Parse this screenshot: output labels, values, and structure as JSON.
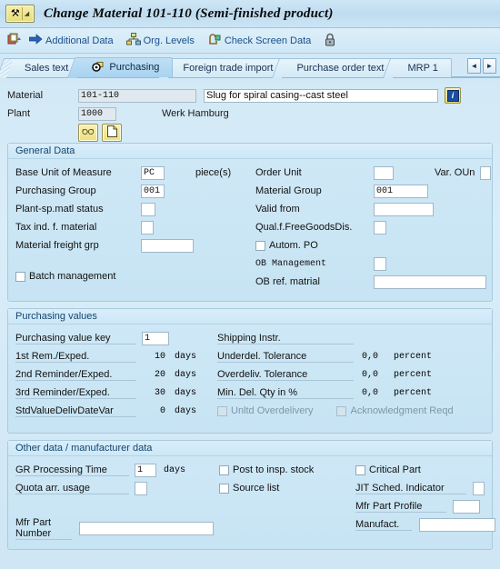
{
  "window": {
    "title": "Change Material 101-110 (Semi-finished product)",
    "system_icon": "sap-material-icon"
  },
  "toolbar": {
    "items": [
      {
        "icon": "create-copy-icon",
        "label": ""
      },
      {
        "icon": "arrow-right-icon",
        "label": "Additional Data"
      },
      {
        "icon": "org-levels-icon",
        "label": "Org. Levels"
      },
      {
        "icon": "check-screen-icon",
        "label": "Check Screen Data"
      },
      {
        "icon": "lock-icon",
        "label": ""
      }
    ]
  },
  "tabs": {
    "items": [
      {
        "label": "Sales text",
        "active": false,
        "icon": ""
      },
      {
        "label": "Purchasing",
        "active": true,
        "icon": "purchasing-icon"
      },
      {
        "label": "Foreign trade import",
        "active": false,
        "icon": ""
      },
      {
        "label": "Purchase order text",
        "active": false,
        "icon": ""
      },
      {
        "label": "MRP 1",
        "active": false,
        "icon": ""
      }
    ],
    "nav_prev": "◄",
    "nav_next": "►"
  },
  "header": {
    "material_label": "Material",
    "material_value": "101-110",
    "material_desc": "Slug for spiral casing--cast steel",
    "plant_label": "Plant",
    "plant_value": "1000",
    "plant_desc": "Werk Hamburg",
    "info_icon": "info-icon",
    "long_text_icon": "glasses-icon",
    "doc_icon": "document-icon"
  },
  "general_data": {
    "title": "General Data",
    "base_unit_label": "Base Unit of Measure",
    "base_unit_value": "PC",
    "base_unit_text": "piece(s)",
    "purchasing_group_label": "Purchasing Group",
    "purchasing_group_value": "001",
    "plant_status_label": "Plant-sp.matl status",
    "plant_status_value": "",
    "tax_ind_label": "Tax ind. f. material",
    "tax_ind_value": "",
    "freight_grp_label": "Material freight grp",
    "freight_grp_value": "",
    "batch_mgmt_label": "Batch management",
    "batch_mgmt_checked": false,
    "order_unit_label": "Order Unit",
    "order_unit_value": "",
    "var_oun_label": "Var. OUn",
    "var_oun_value": "",
    "material_group_label": "Material Group",
    "material_group_value": "001",
    "valid_from_label": "Valid from",
    "valid_from_value": "",
    "qual_free_goods_label": "Qual.f.FreeGoodsDis.",
    "qual_free_goods_value": "",
    "autom_po_label": "Autom. PO",
    "autom_po_checked": false,
    "ob_management_label": "OB Management",
    "ob_management_value": "",
    "ob_ref_label": "OB ref. matrial",
    "ob_ref_value": ""
  },
  "purchasing_values": {
    "title": "Purchasing values",
    "value_key_label": "Purchasing value key",
    "value_key_value": "1",
    "rem1_label": "1st Rem./Exped.",
    "rem1_value": "10",
    "rem1_unit": "days",
    "rem2_label": "2nd Reminder/Exped.",
    "rem2_value": "20",
    "rem2_unit": "days",
    "rem3_label": "3rd Reminder/Exped.",
    "rem3_value": "30",
    "rem3_unit": "days",
    "stdvalue_label": "StdValueDelivDateVar",
    "stdvalue_value": "0",
    "stdvalue_unit": "days",
    "shipping_instr_label": "Shipping Instr.",
    "underdel_label": "Underdel. Tolerance",
    "underdel_value": "0,0",
    "underdel_unit": "percent",
    "overdeliv_label": "Overdeliv. Tolerance",
    "overdeliv_value": "0,0",
    "overdeliv_unit": "percent",
    "mindel_label": "Min. Del. Qty in %",
    "mindel_value": "0,0",
    "mindel_unit": "percent",
    "unltd_label": "Unltd Overdelivery",
    "unltd_checked": false,
    "ack_label": "Acknowledgment Reqd",
    "ack_checked": false
  },
  "other_data": {
    "title": "Other data / manufacturer data",
    "gr_time_label": "GR Processing Time",
    "gr_time_value": "1",
    "gr_time_unit": "days",
    "quota_label": "Quota arr. usage",
    "quota_value": "",
    "post_insp_label": "Post to insp. stock",
    "post_insp_checked": false,
    "source_list_label": "Source list",
    "source_list_checked": false,
    "critical_part_label": "Critical Part",
    "critical_part_checked": false,
    "jit_label": "JIT Sched. Indicator",
    "jit_value": "",
    "mfr_profile_label": "Mfr Part Profile",
    "mfr_profile_value": "",
    "mfr_part_label": "Mfr Part Number",
    "mfr_part_value": "",
    "manufact_label": "Manufact.",
    "manufact_value": ""
  },
  "colors": {
    "page_bg": "#cfe6f5",
    "group_bg": "#cbe5f4",
    "accent_link": "#174e8c",
    "active_tab": "#a8d3f0",
    "yellow_button": "#efe28a"
  }
}
